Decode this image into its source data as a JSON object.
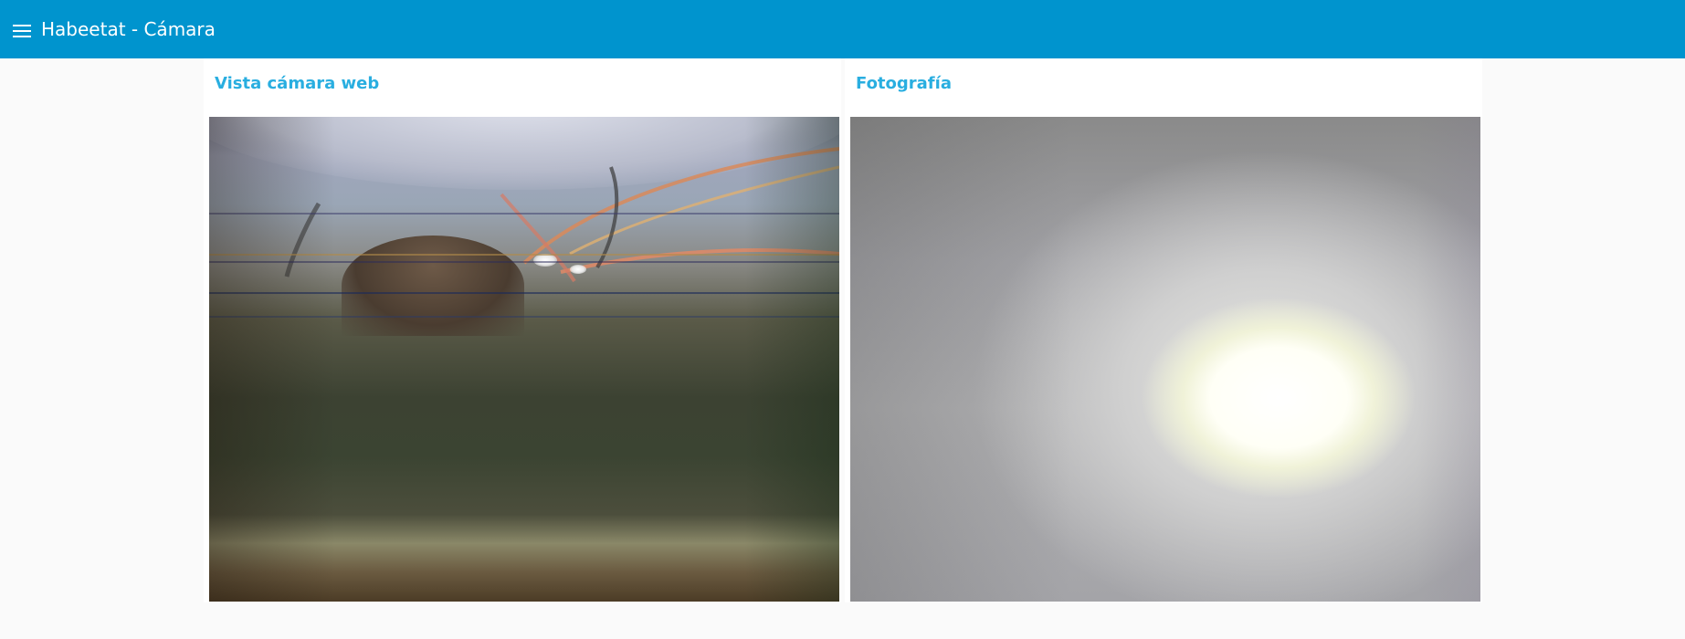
{
  "topbar": {
    "menu_icon": "hamburger-menu-icon",
    "title": "Habeetat - Cámara",
    "color": "#0094ce"
  },
  "panels": [
    {
      "title": "Vista cámara web",
      "content": "webcam-live-view"
    },
    {
      "title": "Fotografía",
      "content": "photo-snapshot"
    }
  ],
  "colors": {
    "panel_title": "#29aee0",
    "page_background": "#fafafa"
  }
}
